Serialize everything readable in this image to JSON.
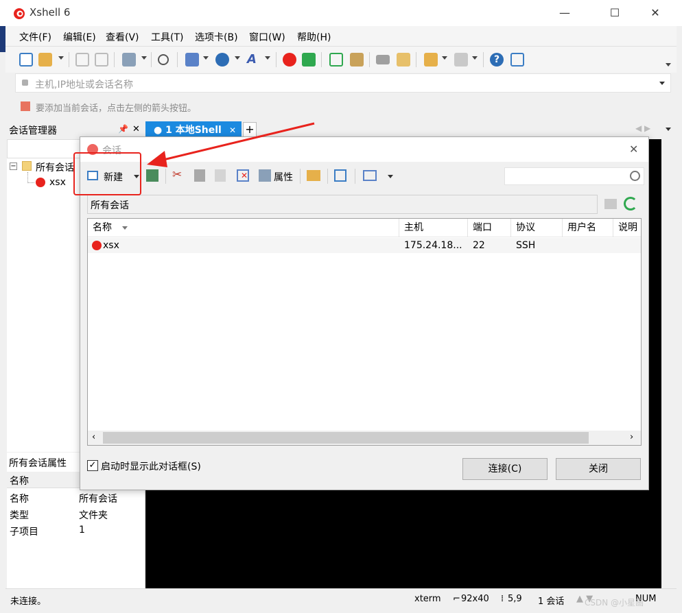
{
  "window": {
    "title": "Xshell 6",
    "brand_color": "#e8231d"
  },
  "menubar": {
    "items": [
      "文件(F)",
      "编辑(E)",
      "查看(V)",
      "工具(T)",
      "选项卡(B)",
      "窗口(W)",
      "帮助(H)"
    ]
  },
  "address_bar": {
    "placeholder": "主机,IP地址或会话名称"
  },
  "hint_bar": {
    "text": "要添加当前会话，点击左侧的箭头按钮。"
  },
  "session_manager": {
    "title": "会话管理器",
    "tree": {
      "root": "所有会话",
      "children": [
        "xsx"
      ]
    }
  },
  "tab": {
    "label": "1 本地Shell",
    "add": "+"
  },
  "properties": {
    "title": "所有会话属性",
    "header": "名称",
    "rows": [
      {
        "key": "名称",
        "value": "所有会话"
      },
      {
        "key": "类型",
        "value": "文件夹"
      },
      {
        "key": "子项目",
        "value": "1"
      }
    ]
  },
  "dialog": {
    "title": "会话",
    "toolbar": {
      "new_label": "新建",
      "properties_label": "属性"
    },
    "path": "所有会话",
    "columns": [
      "名称",
      "主机",
      "端口",
      "协议",
      "用户名",
      "说明"
    ],
    "rows": [
      {
        "name": "xsx",
        "host": "175.24.18...",
        "port": "22",
        "protocol": "SSH",
        "user": "",
        "desc": ""
      }
    ],
    "startup_checkbox": "启动时显示此对话框(S)",
    "startup_checked": true,
    "connect_label": "连接(C)",
    "close_label": "关闭"
  },
  "statusbar": {
    "left": "未连接。",
    "term": "xterm",
    "size": "92x40",
    "pos": "5,9",
    "sessions": "1 会话",
    "num": "NUM",
    "watermark": "CSDN @小星画"
  }
}
